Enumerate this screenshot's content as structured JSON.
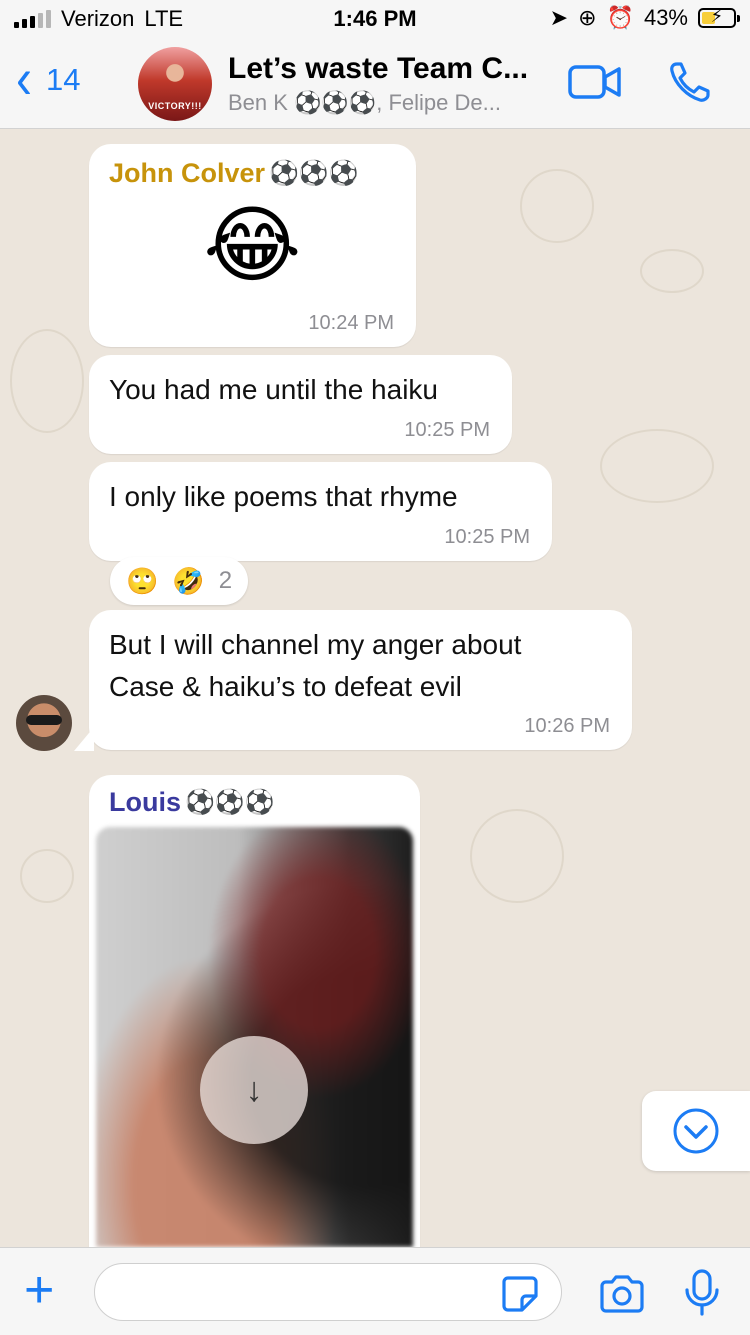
{
  "status_bar": {
    "carrier": "Verizon",
    "network": "LTE",
    "time": "1:46 PM",
    "battery_percent": "43%",
    "battery_level": 0.43
  },
  "header": {
    "back_count": "14",
    "avatar_label": "VICTORY!!!",
    "title": "Let’s waste Team C...",
    "subtitle": "Ben K ⚽⚽⚽, Felipe De..."
  },
  "messages": [
    {
      "sender": "John Colver",
      "sender_suffix": "⚽⚽⚽",
      "sender_color": "#c7930b",
      "text": "😂",
      "time": "10:24 PM"
    },
    {
      "text": "You had me until the haiku",
      "time": "10:25 PM"
    },
    {
      "text": "I only like poems that rhyme",
      "time": "10:25 PM"
    },
    {
      "text_line1": "But I will channel my anger about",
      "text_line2": "Case & haiku’s to defeat evil",
      "time": "10:26 PM"
    },
    {
      "sender": "Louis",
      "sender_suffix": "⚽⚽⚽",
      "sender_color": "#3a3a9e"
    }
  ],
  "reactions": {
    "emoji1": "🙄",
    "emoji2": "🤣",
    "count": "2"
  },
  "input": {
    "placeholder": ""
  },
  "colors": {
    "accent": "#1c7cf4",
    "chat_bg": "#ece5dc"
  }
}
